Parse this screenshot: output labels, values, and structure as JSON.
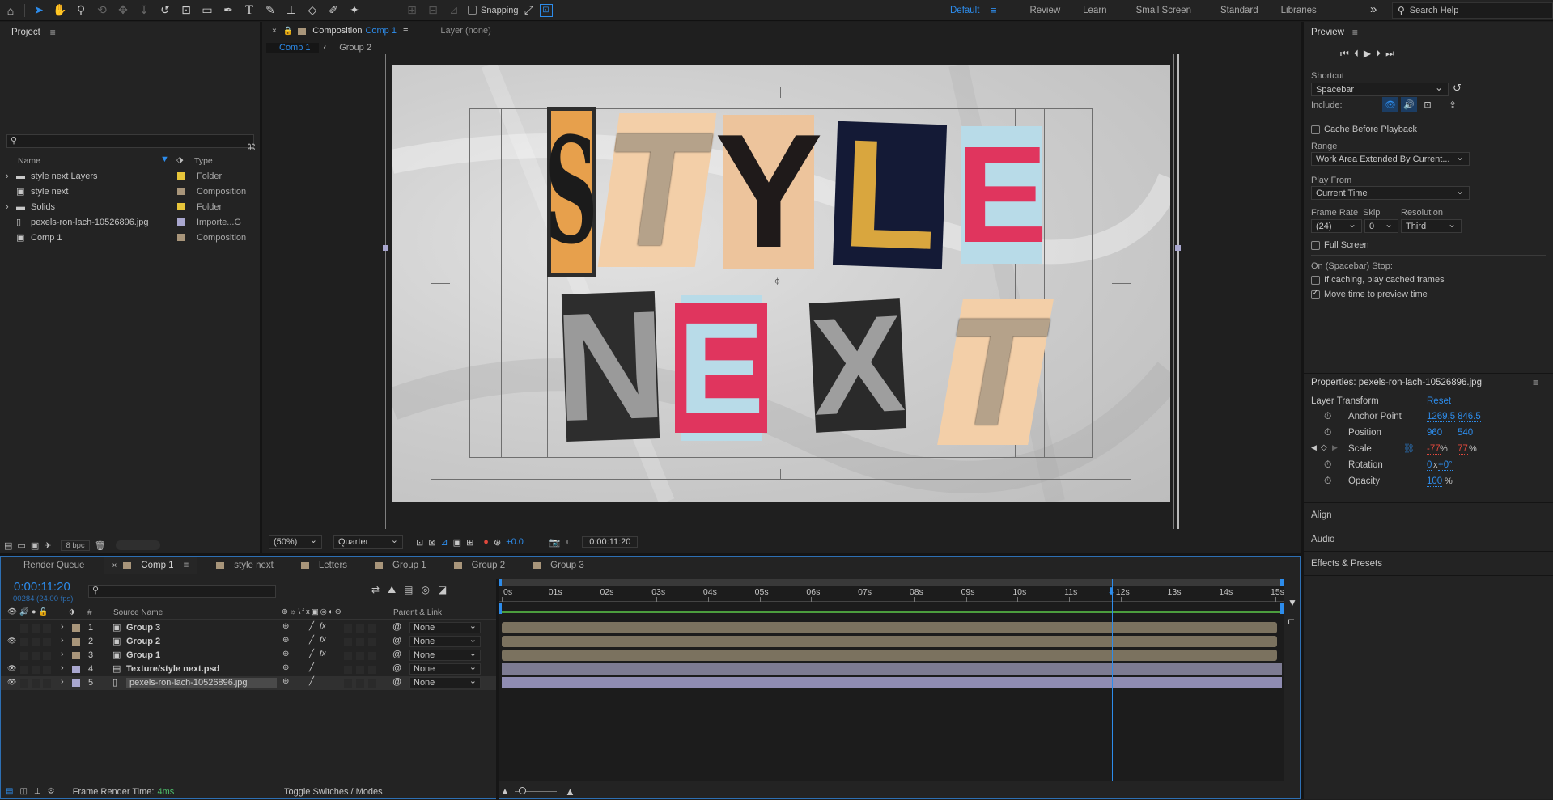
{
  "toolbar": {
    "snapping_label": "Snapping",
    "workspaces": [
      "Default",
      "Review",
      "Learn",
      "Small Screen",
      "Standard",
      "Libraries"
    ],
    "active_workspace": "Default",
    "search_placeholder": "Search Help"
  },
  "project": {
    "title": "Project",
    "columns": {
      "name": "Name",
      "type": "Type"
    },
    "items": [
      {
        "name": "style next Layers",
        "type": "Folder",
        "color": "#e7c53a",
        "icon": "folder-icon",
        "expandable": true
      },
      {
        "name": "style next",
        "type": "Composition",
        "color": "#a8957a",
        "icon": "composition-icon",
        "expandable": false
      },
      {
        "name": "Solids",
        "type": "Folder",
        "color": "#e7c53a",
        "icon": "folder-icon",
        "expandable": true
      },
      {
        "name": "pexels-ron-lach-10526896.jpg",
        "type": "Importe...G",
        "color": "#a9a7cf",
        "icon": "image-file-icon",
        "expandable": false
      },
      {
        "name": "Comp 1",
        "type": "Composition",
        "color": "#a8957a",
        "icon": "composition-icon",
        "expandable": false
      }
    ],
    "bpc": "8 bpc"
  },
  "composition": {
    "tab_prefix": "Composition",
    "tab_name": "Comp 1",
    "layer_tab": "Layer (none)",
    "breadcrumbs": [
      "Comp 1",
      "Group 2"
    ],
    "zoom": "(50%)",
    "resolution": "Quarter",
    "exposure": "+0.0",
    "timecode": "0:00:11:20",
    "letters_row1": [
      "S",
      "T",
      "Y",
      "L",
      "E"
    ],
    "letters_row2": [
      "N",
      "E",
      "X",
      "T"
    ]
  },
  "preview": {
    "title": "Preview",
    "shortcut_label": "Shortcut",
    "shortcut_value": "Spacebar",
    "include_label": "Include:",
    "cache_label": "Cache Before Playback",
    "range_label": "Range",
    "range_value": "Work Area Extended By Current...",
    "play_from_label": "Play From",
    "play_from_value": "Current Time",
    "frame_rate_label": "Frame Rate",
    "skip_label": "Skip",
    "resolution_label": "Resolution",
    "frame_rate_value": "(24)",
    "skip_value": "0",
    "resolution_value": "Third",
    "full_screen_label": "Full Screen",
    "stop_label": "On (Spacebar) Stop:",
    "if_caching_label": "If caching, play cached frames",
    "move_time_label": "Move time to preview time",
    "move_time_checked": true
  },
  "properties": {
    "title": "Properties: pexels-ron-lach-10526896.jpg",
    "section": "Layer Transform",
    "reset": "Reset",
    "rows": [
      {
        "label": "Anchor Point",
        "v1": "1269.5",
        "v2": "846.5"
      },
      {
        "label": "Position",
        "v1": "960",
        "v2": "540"
      },
      {
        "label": "Scale",
        "v1": "-77",
        "v2": "77",
        "unit": "%"
      },
      {
        "label": "Rotation",
        "v1": "0",
        "v1_suffix": "x",
        "v2": "+0°"
      },
      {
        "label": "Opacity",
        "v1": "100",
        "unit": "%"
      }
    ],
    "collapsed": [
      "Align",
      "Audio",
      "Effects & Presets"
    ]
  },
  "timeline": {
    "tabs": [
      {
        "label": "Render Queue",
        "color": null,
        "active": false,
        "closable": false
      },
      {
        "label": "Comp 1",
        "color": "#a8957a",
        "active": true,
        "closable": true
      },
      {
        "label": "style next",
        "color": "#a8957a",
        "active": false,
        "closable": false
      },
      {
        "label": "Letters",
        "color": "#a8957a",
        "active": false,
        "closable": false
      },
      {
        "label": "Group 1",
        "color": "#a8957a",
        "active": false,
        "closable": false
      },
      {
        "label": "Group 2",
        "color": "#a8957a",
        "active": false,
        "closable": false
      },
      {
        "label": "Group 3",
        "color": "#a8957a",
        "active": false,
        "closable": false
      }
    ],
    "current_time": "0:00:11:20",
    "frames": "00284 (24.00 fps)",
    "col_source_name": "Source Name",
    "col_parent": "Parent & Link",
    "col_hash": "#",
    "ruler": [
      "0s",
      "01s",
      "02s",
      "03s",
      "04s",
      "05s",
      "06s",
      "07s",
      "08s",
      "09s",
      "10s",
      "11s",
      "12s",
      "13s",
      "14s",
      "15s"
    ],
    "playhead_seconds": 11.83,
    "duration_seconds": 15,
    "layers": [
      {
        "num": "1",
        "name": "Group 3",
        "color": "#a8957a",
        "icon": "precomp-icon",
        "parent": "None",
        "fx": true,
        "visible": false,
        "bar_color": "#7b725f"
      },
      {
        "num": "2",
        "name": "Group 2",
        "color": "#a8957a",
        "icon": "precomp-icon",
        "parent": "None",
        "fx": true,
        "visible": true,
        "bar_color": "#7b725f"
      },
      {
        "num": "3",
        "name": "Group 1",
        "color": "#a8957a",
        "icon": "precomp-icon",
        "parent": "None",
        "fx": true,
        "visible": false,
        "bar_color": "#7b725f"
      },
      {
        "num": "4",
        "name": "Texture/style next.psd",
        "color": "#a9a7cf",
        "icon": "psd-file-icon",
        "parent": "None",
        "fx": false,
        "visible": true,
        "bar_color": "#7d7b92"
      },
      {
        "num": "5",
        "name": "pexels-ron-lach-10526896.jpg",
        "color": "#a9a7cf",
        "icon": "image-file-icon",
        "parent": "None",
        "fx": false,
        "visible": true,
        "bar_color": "#8f8cb2",
        "selected": true
      }
    ],
    "frame_render_label": "Frame Render Time:",
    "frame_render_value": "4ms",
    "toggle_label": "Toggle Switches / Modes"
  }
}
